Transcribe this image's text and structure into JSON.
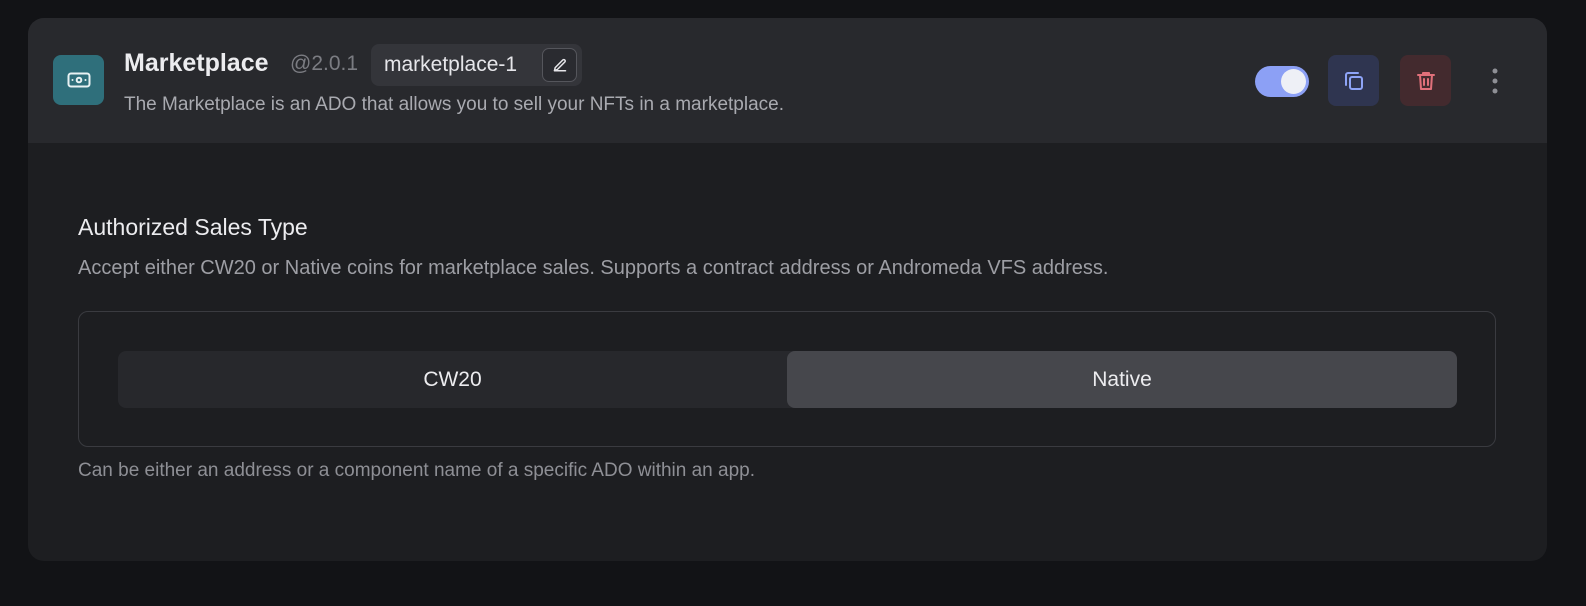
{
  "ado": {
    "title": "Marketplace",
    "version": "@2.0.1",
    "instance_name": "marketplace-1",
    "description": "The Marketplace is an ADO that allows you to sell your NFTs in a marketplace.",
    "enabled": true,
    "icon": "banknote-icon"
  },
  "actions": {
    "toggle_icon": "toggle-on",
    "copy_icon": "copy-icon",
    "delete_icon": "trash-icon",
    "more_icon": "kebab-vertical-icon",
    "edit_icon": "pencil-icon"
  },
  "field": {
    "title": "Authorized Sales Type",
    "description": "Accept either CW20 or Native coins for marketplace sales. Supports a contract address or Andromeda VFS address.",
    "options": [
      "CW20",
      "Native"
    ],
    "selected": "Native",
    "hint": "Can be either an address or a component name of a specific ADO within an app."
  },
  "colors": {
    "accent": "#8ca0f5",
    "icon_bg": "#2f6f7b",
    "danger": "#e0707a",
    "copy": "#8ea4f7"
  }
}
